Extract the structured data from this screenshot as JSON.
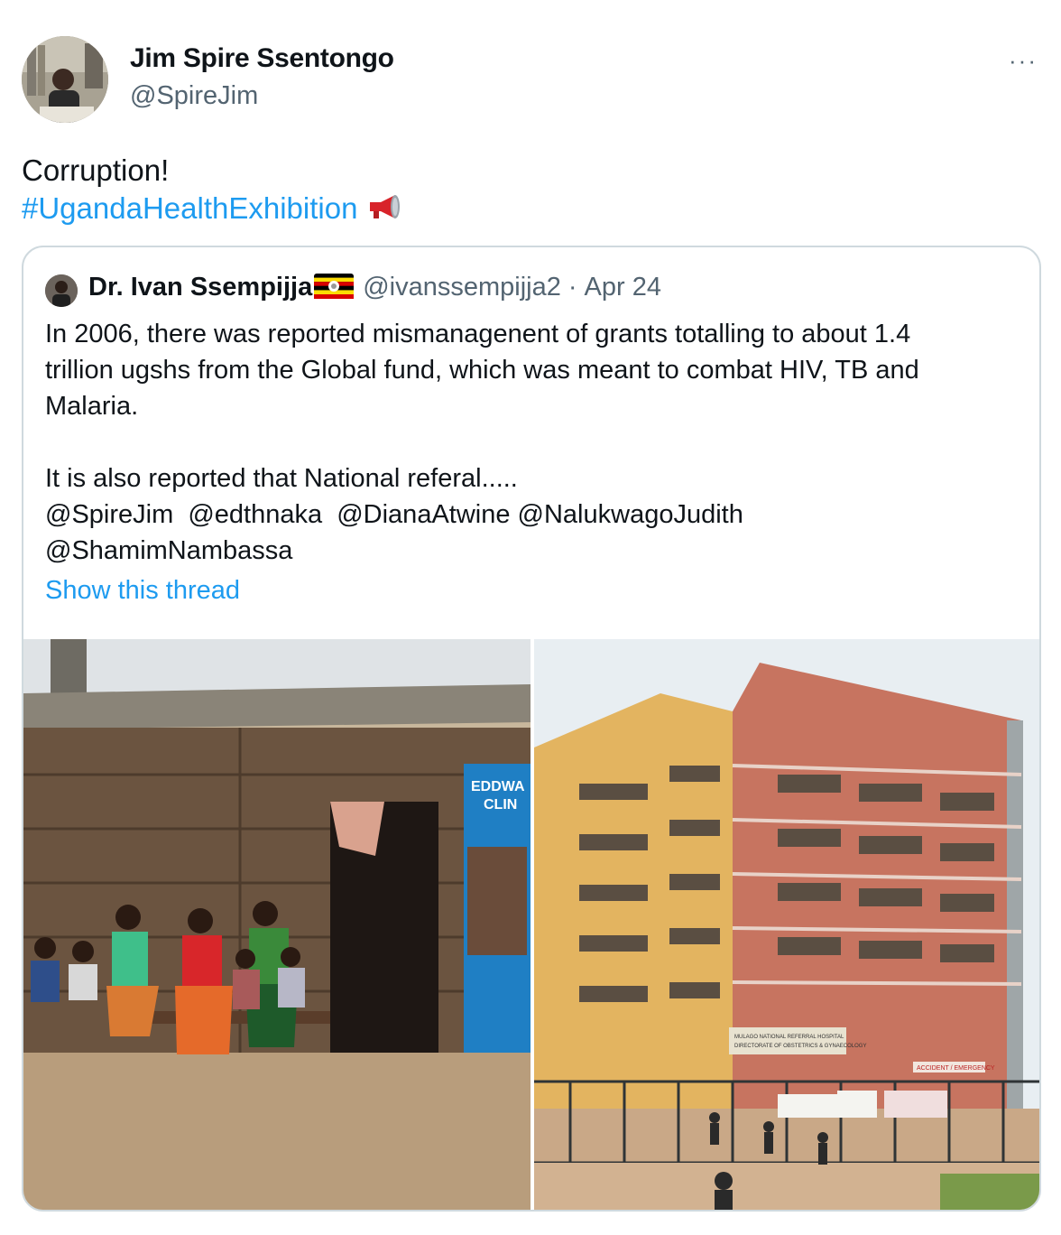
{
  "tweet": {
    "author_name": "Jim Spire Ssentongo",
    "author_handle": "@SpireJim",
    "more_label": "···",
    "text_line1": "Corruption!",
    "hashtag": "#UgandaHealthExhibition",
    "megaphone_icon": "megaphone-icon"
  },
  "quote": {
    "author_name": "Dr. Ivan Ssempijja",
    "flag_icon": "uganda-flag-icon",
    "author_handle": "@ivanssempijja2",
    "separator": "·",
    "date": "Apr 24",
    "body_lines": [
      "In 2006, there was reported mismanagenent of grants totalling to about 1.4",
      "trillion ugshs from the Global fund, which was meant to combat HIV, TB and",
      "Malaria.",
      "",
      "It is also reported that National referal.....",
      "@SpireJim  @edthnaka  @DianaAtwine @NalukwagoJudith",
      "@ShamimNambassa"
    ],
    "show_thread": "Show this thread"
  },
  "media": {
    "left_sign_text": [
      "EDDWA",
      "CLIN"
    ],
    "right_sign_text": [
      "MULAGO NATIONAL REFERRAL HOSPITAL",
      "DIRECTORATE OF OBSTETRICS & GYNAECOLOGY"
    ],
    "right_emergency_text": "ACCIDENT / EMERGENCY"
  },
  "colors": {
    "link": "#1d9bf0",
    "secondary": "#536471",
    "border": "#cfd9de"
  }
}
